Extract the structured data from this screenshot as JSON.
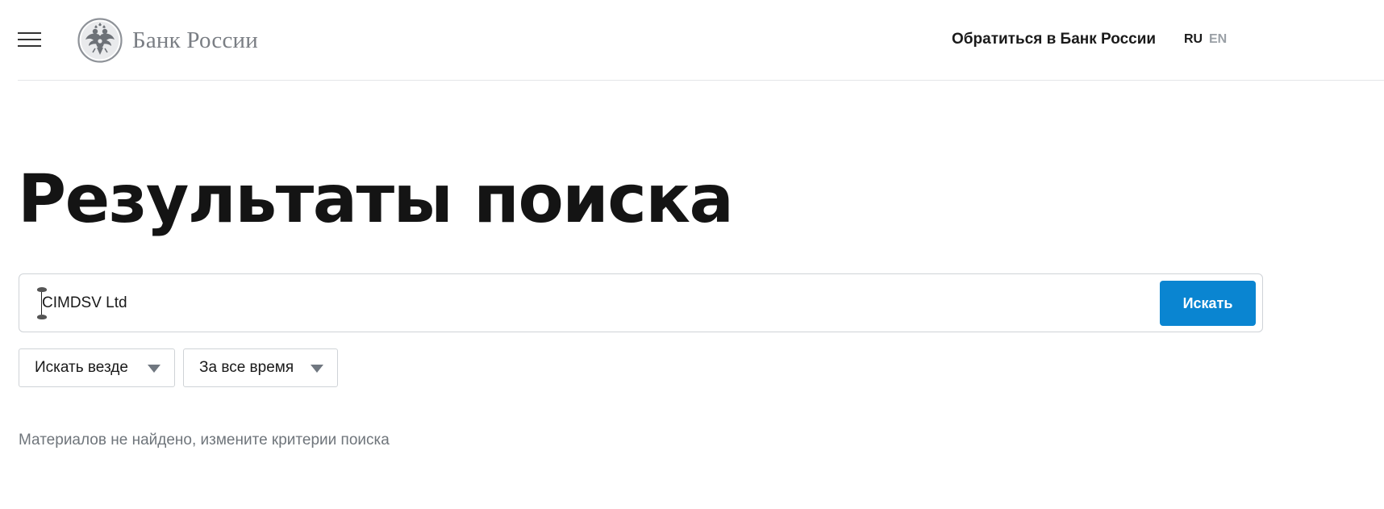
{
  "header": {
    "logo_text": "Банк России",
    "contact_link": "Обратиться в Банк России",
    "lang_ru": "RU",
    "lang_en": "EN"
  },
  "page": {
    "title": "Результаты поиска"
  },
  "search": {
    "query": "CIMDSV Ltd",
    "button_label": "Искать"
  },
  "filters": {
    "scope_selected": "Искать везде",
    "period_selected": "За все время"
  },
  "results": {
    "empty_message": "Материалов не найдено, измените критерии поиска"
  },
  "colors": {
    "accent_button": "#0a85d1",
    "logo_gray": "#7a7e84",
    "muted_text": "#6f757b"
  },
  "icons": {
    "menu": "hamburger-menu-icon",
    "logo": "double-headed-eagle-emblem",
    "dropdown": "triangle-down-icon"
  }
}
